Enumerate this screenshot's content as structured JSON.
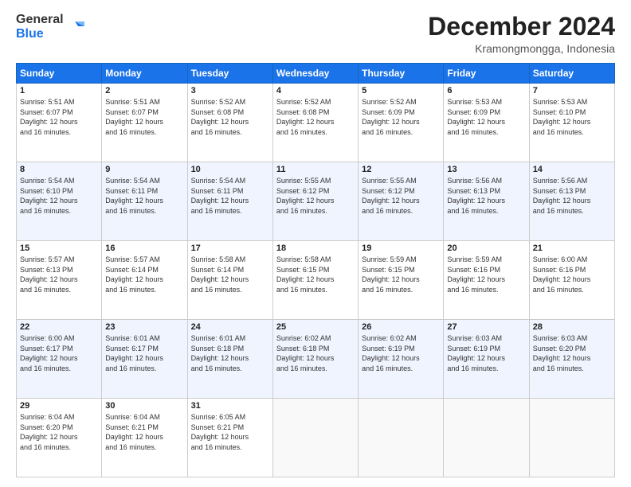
{
  "logo": {
    "line1": "General",
    "line2": "Blue"
  },
  "title": "December 2024",
  "location": "Kramongmongga, Indonesia",
  "days_of_week": [
    "Sunday",
    "Monday",
    "Tuesday",
    "Wednesday",
    "Thursday",
    "Friday",
    "Saturday"
  ],
  "weeks": [
    [
      {
        "day": "1",
        "sunrise": "5:51 AM",
        "sunset": "6:07 PM",
        "daylight": "12 hours and 16 minutes."
      },
      {
        "day": "2",
        "sunrise": "5:51 AM",
        "sunset": "6:07 PM",
        "daylight": "12 hours and 16 minutes."
      },
      {
        "day": "3",
        "sunrise": "5:52 AM",
        "sunset": "6:08 PM",
        "daylight": "12 hours and 16 minutes."
      },
      {
        "day": "4",
        "sunrise": "5:52 AM",
        "sunset": "6:08 PM",
        "daylight": "12 hours and 16 minutes."
      },
      {
        "day": "5",
        "sunrise": "5:52 AM",
        "sunset": "6:09 PM",
        "daylight": "12 hours and 16 minutes."
      },
      {
        "day": "6",
        "sunrise": "5:53 AM",
        "sunset": "6:09 PM",
        "daylight": "12 hours and 16 minutes."
      },
      {
        "day": "7",
        "sunrise": "5:53 AM",
        "sunset": "6:10 PM",
        "daylight": "12 hours and 16 minutes."
      }
    ],
    [
      {
        "day": "8",
        "sunrise": "5:54 AM",
        "sunset": "6:10 PM",
        "daylight": "12 hours and 16 minutes."
      },
      {
        "day": "9",
        "sunrise": "5:54 AM",
        "sunset": "6:11 PM",
        "daylight": "12 hours and 16 minutes."
      },
      {
        "day": "10",
        "sunrise": "5:54 AM",
        "sunset": "6:11 PM",
        "daylight": "12 hours and 16 minutes."
      },
      {
        "day": "11",
        "sunrise": "5:55 AM",
        "sunset": "6:12 PM",
        "daylight": "12 hours and 16 minutes."
      },
      {
        "day": "12",
        "sunrise": "5:55 AM",
        "sunset": "6:12 PM",
        "daylight": "12 hours and 16 minutes."
      },
      {
        "day": "13",
        "sunrise": "5:56 AM",
        "sunset": "6:13 PM",
        "daylight": "12 hours and 16 minutes."
      },
      {
        "day": "14",
        "sunrise": "5:56 AM",
        "sunset": "6:13 PM",
        "daylight": "12 hours and 16 minutes."
      }
    ],
    [
      {
        "day": "15",
        "sunrise": "5:57 AM",
        "sunset": "6:13 PM",
        "daylight": "12 hours and 16 minutes."
      },
      {
        "day": "16",
        "sunrise": "5:57 AM",
        "sunset": "6:14 PM",
        "daylight": "12 hours and 16 minutes."
      },
      {
        "day": "17",
        "sunrise": "5:58 AM",
        "sunset": "6:14 PM",
        "daylight": "12 hours and 16 minutes."
      },
      {
        "day": "18",
        "sunrise": "5:58 AM",
        "sunset": "6:15 PM",
        "daylight": "12 hours and 16 minutes."
      },
      {
        "day": "19",
        "sunrise": "5:59 AM",
        "sunset": "6:15 PM",
        "daylight": "12 hours and 16 minutes."
      },
      {
        "day": "20",
        "sunrise": "5:59 AM",
        "sunset": "6:16 PM",
        "daylight": "12 hours and 16 minutes."
      },
      {
        "day": "21",
        "sunrise": "6:00 AM",
        "sunset": "6:16 PM",
        "daylight": "12 hours and 16 minutes."
      }
    ],
    [
      {
        "day": "22",
        "sunrise": "6:00 AM",
        "sunset": "6:17 PM",
        "daylight": "12 hours and 16 minutes."
      },
      {
        "day": "23",
        "sunrise": "6:01 AM",
        "sunset": "6:17 PM",
        "daylight": "12 hours and 16 minutes."
      },
      {
        "day": "24",
        "sunrise": "6:01 AM",
        "sunset": "6:18 PM",
        "daylight": "12 hours and 16 minutes."
      },
      {
        "day": "25",
        "sunrise": "6:02 AM",
        "sunset": "6:18 PM",
        "daylight": "12 hours and 16 minutes."
      },
      {
        "day": "26",
        "sunrise": "6:02 AM",
        "sunset": "6:19 PM",
        "daylight": "12 hours and 16 minutes."
      },
      {
        "day": "27",
        "sunrise": "6:03 AM",
        "sunset": "6:19 PM",
        "daylight": "12 hours and 16 minutes."
      },
      {
        "day": "28",
        "sunrise": "6:03 AM",
        "sunset": "6:20 PM",
        "daylight": "12 hours and 16 minutes."
      }
    ],
    [
      {
        "day": "29",
        "sunrise": "6:04 AM",
        "sunset": "6:20 PM",
        "daylight": "12 hours and 16 minutes."
      },
      {
        "day": "30",
        "sunrise": "6:04 AM",
        "sunset": "6:21 PM",
        "daylight": "12 hours and 16 minutes."
      },
      {
        "day": "31",
        "sunrise": "6:05 AM",
        "sunset": "6:21 PM",
        "daylight": "12 hours and 16 minutes."
      },
      null,
      null,
      null,
      null
    ]
  ],
  "labels": {
    "sunrise": "Sunrise:",
    "sunset": "Sunset:",
    "daylight": "Daylight:"
  }
}
